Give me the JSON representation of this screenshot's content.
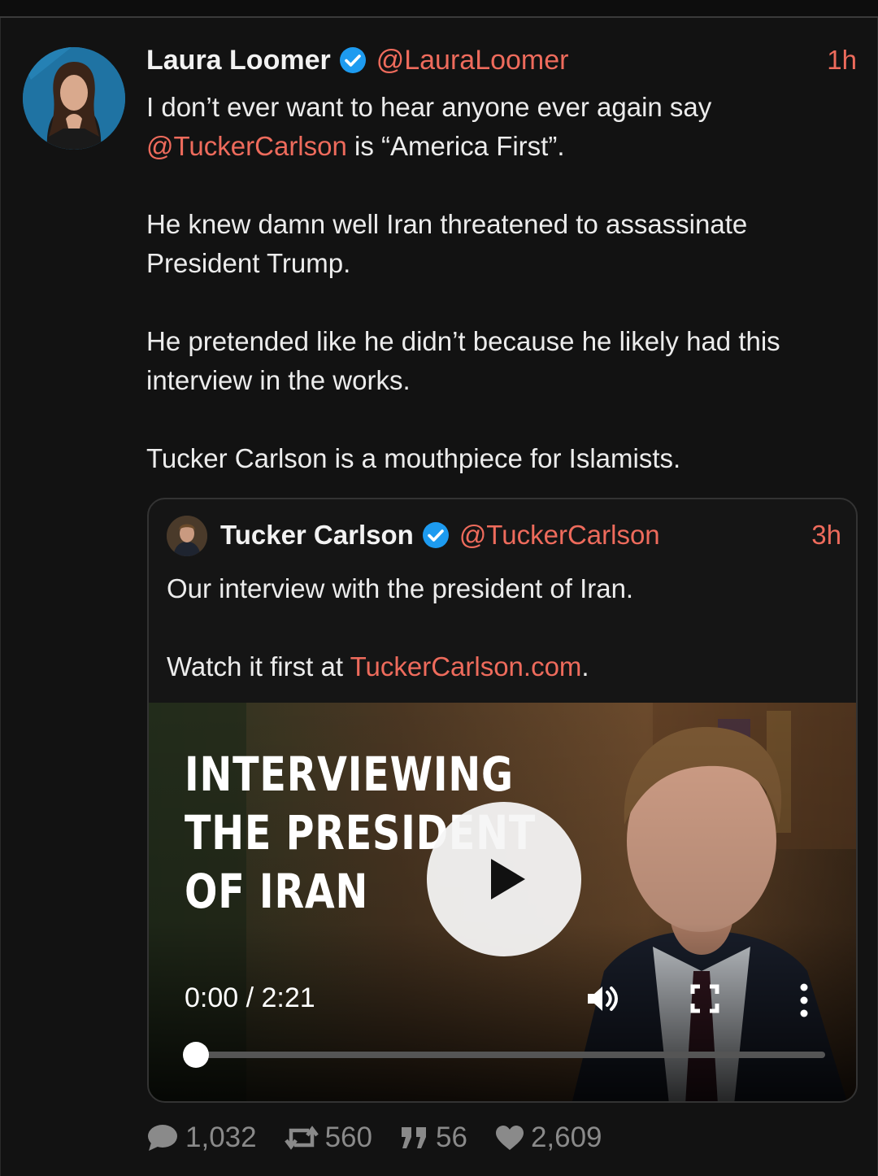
{
  "post": {
    "author_name": "Laura Loomer",
    "handle": "@LauraLoomer",
    "time": "1h",
    "body": {
      "line1": "I don’t ever want to hear anyone ever again say",
      "mention": "@TuckerCarlson",
      "line1_end": " is “America First”.",
      "para2": "He knew damn well Iran threatened to assassinate President Trump.",
      "para3": "He pretended like he didn’t because he likely had this interview in the works.",
      "para4": "Tucker Carlson is a mouthpiece for Islamists."
    },
    "stats": {
      "replies": "1,032",
      "reposts": "560",
      "quotes": "56",
      "likes": "2,609"
    }
  },
  "quoted": {
    "author_name": "Tucker Carlson",
    "handle": "@TuckerCarlson",
    "time": "3h",
    "para1": "Our interview with the president of Iran.",
    "para2_prefix": "Watch it first at ",
    "link": "TuckerCarlson.com",
    "para2_suffix": ".",
    "video": {
      "title_line1": "INTERVIEWING",
      "title_line2": "THE PRESIDENT",
      "title_line3": "OF IRAN",
      "time_display": "0:00 / 2:21",
      "progress": 0
    }
  },
  "colors": {
    "background": "#121212",
    "accent": "#ee6b5c",
    "verified": "#1d9bf0",
    "muted": "#8a8a8a"
  },
  "icons": {
    "verified": "verified-check-icon",
    "reply": "comment-bubble-icon",
    "repost": "repost-icon",
    "quote": "quote-icon",
    "like": "heart-icon",
    "volume": "volume-icon",
    "fullscreen": "fullscreen-icon",
    "more": "more-vertical-icon"
  }
}
